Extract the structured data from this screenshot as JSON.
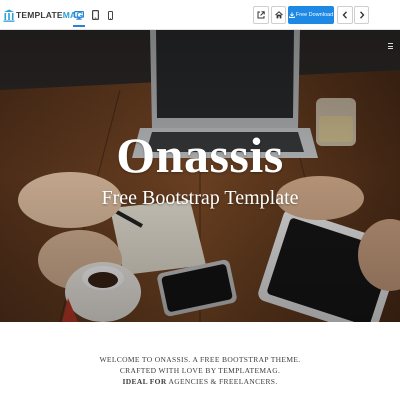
{
  "toolbar": {
    "logo": {
      "prefix": "TEMPLATE",
      "suffix": "MAG"
    },
    "devices": [
      "desktop-icon",
      "tablet-icon",
      "mobile-icon"
    ],
    "download_label": "Free Download",
    "accent_color": "#1e88e5"
  },
  "hero": {
    "title": "Onassis",
    "subtitle": "Free Bootstrap Template"
  },
  "welcome": {
    "line1": "Welcome to Onassis. A free bootstrap theme.",
    "line2": "Crafted with love by Templatemag.",
    "line3_prefix": "Ideal for",
    "line3_rest": "agencies & freelancers."
  }
}
